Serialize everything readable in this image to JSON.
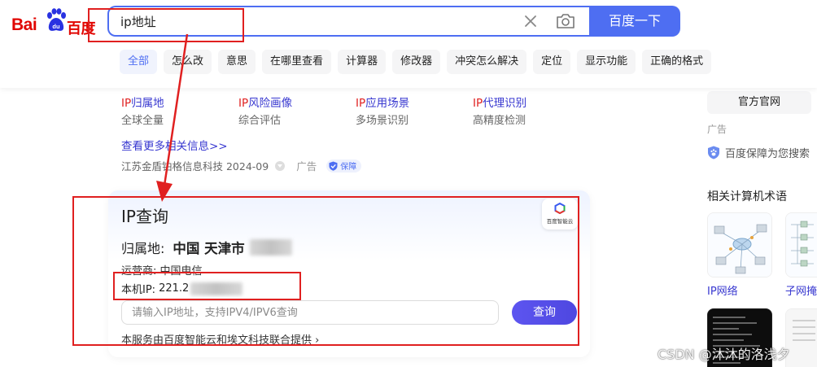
{
  "logo": {
    "part1": "Bai",
    "part2": "百度"
  },
  "search": {
    "query": "ip地址",
    "button_label": "百度一下"
  },
  "tabs": [
    {
      "label": "全部",
      "active": true
    },
    {
      "label": "怎么改"
    },
    {
      "label": "意思"
    },
    {
      "label": "在哪里查看"
    },
    {
      "label": "计算器"
    },
    {
      "label": "修改器"
    },
    {
      "label": "冲突怎么解决"
    },
    {
      "label": "定位"
    },
    {
      "label": "显示功能"
    },
    {
      "label": "正确的格式"
    }
  ],
  "ads": {
    "items": [
      {
        "title_hl": "IP",
        "title_rest": "归属地",
        "sub": "全球全量"
      },
      {
        "title_hl": "IP",
        "title_rest": "风险画像",
        "sub": "综合评估"
      },
      {
        "title_hl": "IP",
        "title_rest": "应用场景",
        "sub": "多场景识别"
      },
      {
        "title_hl": "IP",
        "title_rest": "代理识别",
        "sub": "高精度检测"
      }
    ],
    "more_link": "查看更多相关信息>>",
    "source": "江苏金盾铂格信息科技 2024-09",
    "ad_label": "广告",
    "guarantee_badge": "保障"
  },
  "ip_card": {
    "title": "IP查询",
    "logo_text": "百度智能云",
    "location_label": "归属地:",
    "location_value": "中国 天津市",
    "isp_label": "运营商:",
    "isp_value": "中国电信",
    "my_ip_label": "本机IP:",
    "my_ip_value": "221.2",
    "input_placeholder": "请输入IP地址，支持IPV4/IPV6查询",
    "query_button": "查询",
    "service_text": "本服务由百度智能云和埃文科技联合提供 ›"
  },
  "sidebar": {
    "official_site": "官方官网",
    "ad_label": "广告",
    "guarantee_text": "百度保障为您搜索",
    "related_title": "相关计算机术语",
    "related": [
      {
        "label": "IP网络"
      },
      {
        "label": "子网掩"
      }
    ]
  },
  "watermark": "CSDN @沐沐的洛浅夕",
  "colors": {
    "brand_blue": "#4e6ef2",
    "annotation_red": "#e02020",
    "link_blue": "#3838d0",
    "logo_red": "#e10602"
  }
}
